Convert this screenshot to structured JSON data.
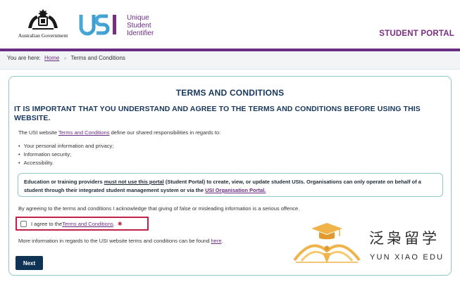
{
  "header": {
    "gov_logo_text": "Australian Government",
    "usi_letters": "USI",
    "usi_words": [
      "Unique",
      "Student",
      "Identifier"
    ],
    "portal_title": "STUDENT PORTAL"
  },
  "breadcrumb": {
    "prefix": "You are here:",
    "home": "Home",
    "current": "Terms and Conditions"
  },
  "page": {
    "title": "TERMS AND CONDITIONS",
    "important": "IT IS IMPORTANT THAT YOU UNDERSTAND AND AGREE TO THE TERMS AND CONDITIONS BEFORE USING THIS WEBSITE.",
    "intro_before": "The USI website ",
    "intro_link": "Terms and Conditions",
    "intro_after": " define our shared responsibilities in regards to:",
    "bullets": [
      "Your personal information and privacy;",
      "Information security;",
      "Accessibility."
    ],
    "notice_part1": "Education or training providers ",
    "notice_underlined": "must not use this portal",
    "notice_part2": " (Student Portal) to create, view, or update student USIs. Organisations can only operate on behalf of a student through their integrated student management system or via the ",
    "notice_link": "USI Organisation Portal.",
    "agree_statement": "By agreeing to the terms and conditions I acknowledge that giving of false or misleading information is a serious offence.",
    "checkbox_label_before": "I agree to the ",
    "checkbox_link": "Terms and Conditions",
    "checkbox_label_after": ".",
    "required_mark": "✱",
    "more_before": "More information in regards to the USI website terms and conditions can be found ",
    "more_link": "here",
    "more_after": ".",
    "next_label": "Next"
  },
  "watermark": {
    "chinese": "泛枭留学",
    "english": "YUN XIAO EDU"
  },
  "colors": {
    "brand_purple": "#6b2c83",
    "navy": "#17365d",
    "button": "#0f3354",
    "teal_border": "#8fc8c4",
    "required_red": "#c0214a",
    "watermark_gold": "#f0b34a"
  }
}
